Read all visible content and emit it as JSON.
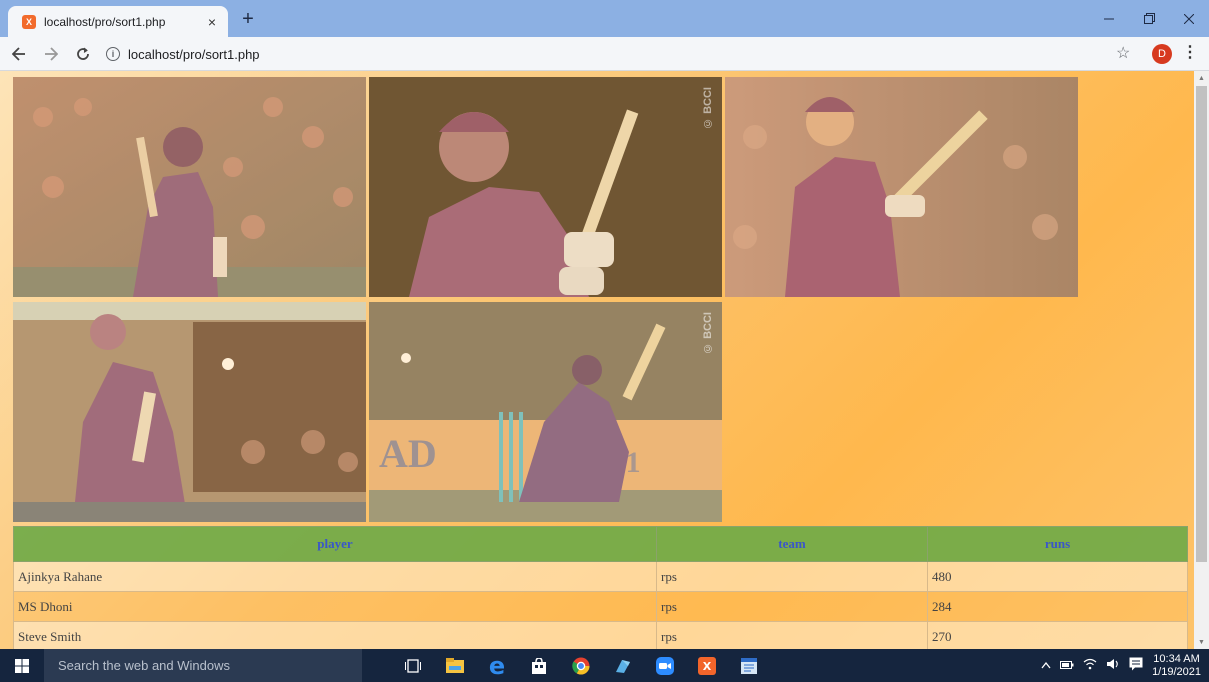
{
  "browser": {
    "tab_title": "localhost/pro/sort1.php",
    "favicon_text": "X",
    "close_symbol": "×",
    "new_tab_symbol": "+",
    "url": "localhost/pro/sort1.php",
    "profile_initial": "D"
  },
  "photos": [
    {
      "id": "player-photo-1",
      "watermark": ""
    },
    {
      "id": "player-photo-2",
      "watermark": "© BCCI"
    },
    {
      "id": "player-photo-3",
      "watermark": ""
    },
    {
      "id": "player-photo-4",
      "watermark": ""
    },
    {
      "id": "player-photo-5",
      "watermark": "© BCCI"
    }
  ],
  "table": {
    "headers": [
      "player",
      "team",
      "runs"
    ],
    "rows": [
      [
        "Ajinkya Rahane",
        "rps",
        "480"
      ],
      [
        "MS Dhoni",
        "rps",
        "284"
      ],
      [
        "Steve Smith",
        "rps",
        "270"
      ]
    ]
  },
  "taskbar": {
    "search_placeholder": "Search the web and Windows",
    "time": "10:34 AM",
    "date": "1/19/2021"
  },
  "colors": {
    "header_green": "#70aa48",
    "header_text": "#3a57c9",
    "page_gradient": "#ffb84d",
    "tabstrip": "#8cb0e3",
    "taskbar": "#15253e"
  }
}
